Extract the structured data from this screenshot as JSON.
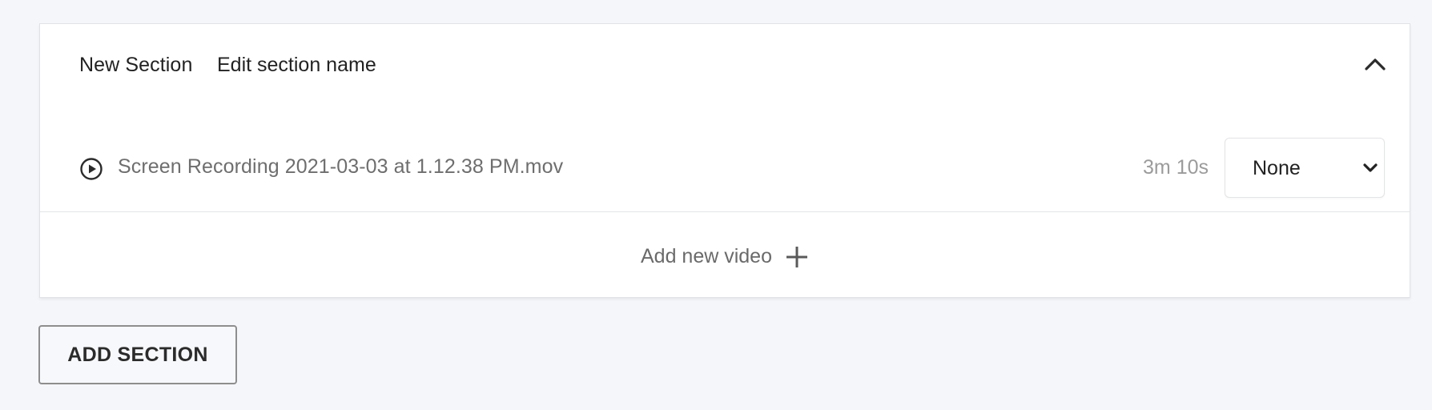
{
  "section": {
    "title": "New Section",
    "edit_label": "Edit section name",
    "collapse_icon": "chevron-up-icon"
  },
  "videos": [
    {
      "name": "Screen Recording 2021-03-03 at 1.12.38 PM.mov",
      "duration": "3m 10s",
      "visibility": "None",
      "icon": "play-circle-icon"
    }
  ],
  "add_video": {
    "label": "Add new video",
    "icon": "plus-icon"
  },
  "add_section": {
    "label": "ADD SECTION"
  },
  "colors": {
    "background": "#f5f6fa",
    "card": "#ffffff",
    "muted_text": "#6e6e6e",
    "duration_text": "#9b9b9b"
  }
}
